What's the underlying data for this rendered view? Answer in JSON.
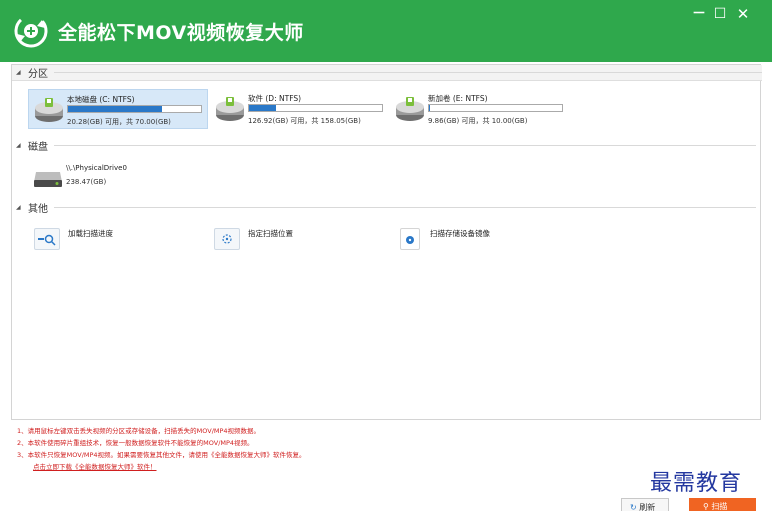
{
  "app": {
    "title": "全能松下MOV视频恢复大师"
  },
  "window_controls": {
    "minimize": "－",
    "maximize": "☐",
    "close": "✕"
  },
  "sections": {
    "partition": "分区",
    "disk": "磁盘",
    "other": "其他"
  },
  "partitions": [
    {
      "name": "本地磁盘 (C: NTFS)",
      "size_text": "20.28(GB) 可用，共 70.00(GB)",
      "used_fraction": 0.71,
      "selected": true
    },
    {
      "name": "软件 (D: NTFS)",
      "size_text": "126.92(GB) 可用，共 158.05(GB)",
      "used_fraction": 0.2,
      "selected": false
    },
    {
      "name": "新加卷 (E: NTFS)",
      "size_text": "9.86(GB) 可用，共 10.00(GB)",
      "used_fraction": 0.01,
      "selected": false
    }
  ],
  "disks": [
    {
      "name": "\\\\.\\PhysicalDrive0",
      "size_text": "238.47(GB)"
    }
  ],
  "tools": [
    {
      "label": "加载扫描进度",
      "icon": "load-scan-icon"
    },
    {
      "label": "指定扫描位置",
      "icon": "target-location-icon"
    },
    {
      "label": "扫描存储设备镜像",
      "icon": "image-file-icon"
    }
  ],
  "notes": [
    "1、请用鼠标左键双击丢失视频的分区或存储设备，扫描丢失的MOV/MP4视频数据。",
    "2、本软件使用碎片重组技术，恢复一般数据恢复软件不能恢复的MOV/MP4视频。",
    "3、本软件只恢复MOV/MP4视频。如果需要恢复其他文件，请使用《全能数据恢复大师》软件恢复。"
  ],
  "download_link": "点击立即下载《全能数据恢复大师》软件！",
  "watermark": "最需教育",
  "buttons": {
    "refresh": "刷新",
    "scan": "扫描"
  },
  "colors": {
    "title_bar": "#2fa84c",
    "progress": "#2a78c8",
    "scan_button": "#f06422",
    "note_text": "#d01f1f"
  }
}
